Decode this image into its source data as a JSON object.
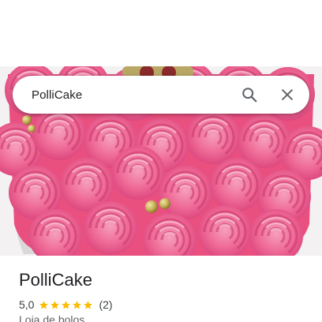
{
  "search": {
    "query": "PolliCake",
    "search_icon": "search-icon",
    "close_icon": "close-icon"
  },
  "hero_image": {
    "subject": "cake-photo",
    "colors": {
      "frosting": "#f06a94",
      "frosting_dark": "#e0447a",
      "pearl": "#c9b45a"
    }
  },
  "place": {
    "title": "PolliCake",
    "rating": "5,0",
    "stars": 5,
    "reviews": "(2)",
    "category": "Loja de bolos",
    "star_color": "#fbbc04"
  }
}
